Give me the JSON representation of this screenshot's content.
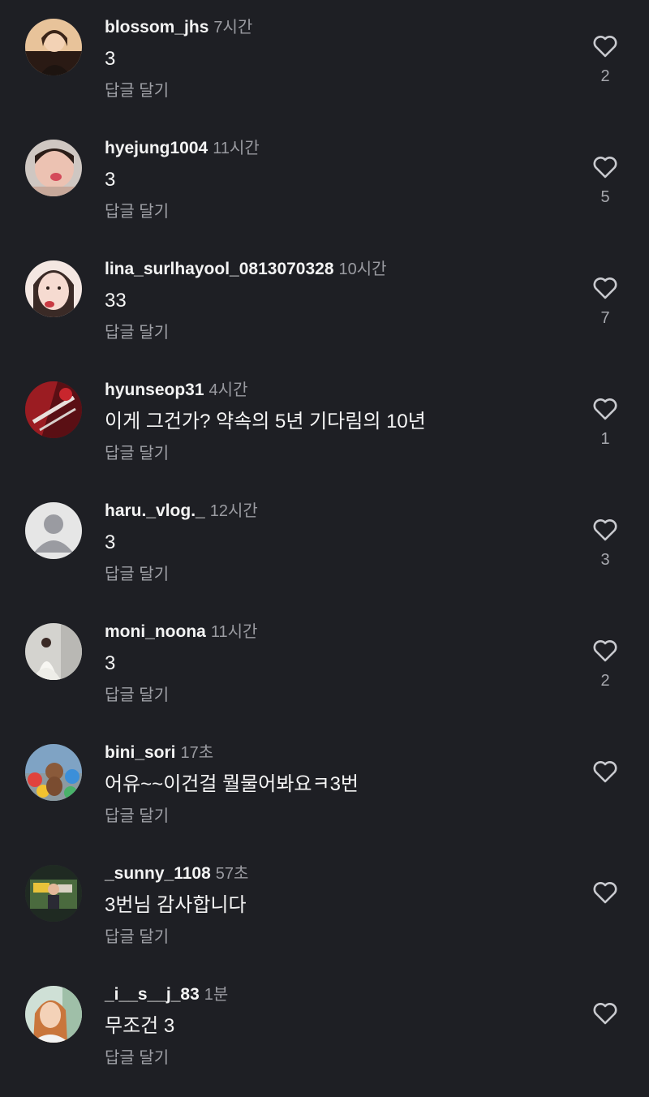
{
  "comments": [
    {
      "username": "blossom_jhs",
      "time": "7시간",
      "text": "3",
      "reply": "답글 달기",
      "likes": "2",
      "avatar": "photo-woman-dark-hair",
      "avatar_color": "#f0c8a0"
    },
    {
      "username": "hyejung1004",
      "time": "11시간",
      "text": "3",
      "reply": "답글 달기",
      "likes": "5",
      "avatar": "photo-face-closeup",
      "avatar_color": "#e8b4a8"
    },
    {
      "username": "lina_surlhayool_0813070328",
      "time": "10시간",
      "text": "33",
      "reply": "답글 달기",
      "likes": "7",
      "avatar": "photo-face-closeup",
      "avatar_color": "#f2d6cc"
    },
    {
      "username": "hyunseop31",
      "time": "4시간",
      "text": "이게 그건가? 약속의 5년 기다림의 10년",
      "reply": "답글 달기",
      "likes": "1",
      "avatar": "photo-red-artwork",
      "avatar_color": "#8a1e22"
    },
    {
      "username": "haru._vlog._",
      "time": "12시간",
      "text": "3",
      "reply": "답글 달기",
      "likes": "3",
      "avatar": "default-user-icon",
      "avatar_color": "#e6e6e6"
    },
    {
      "username": "moni_noona",
      "time": "11시간",
      "text": "3",
      "reply": "답글 달기",
      "likes": "2",
      "avatar": "photo-wedding-dress",
      "avatar_color": "#d9d7d2"
    },
    {
      "username": "bini_sori",
      "time": "17초",
      "text": "어유~~이건걸 뭘물어봐요ㅋ3번",
      "reply": "답글 달기",
      "likes": "",
      "avatar": "photo-dog-colorful-balls",
      "avatar_color": "#6a8fb0"
    },
    {
      "username": "_sunny_1108",
      "time": "57초",
      "text": "3번님 감사합니다",
      "reply": "답글 달기",
      "likes": "",
      "avatar": "photo-tv-screen",
      "avatar_color": "#2f3a2e"
    },
    {
      "username": "_i__s__j_83",
      "time": "1분",
      "text": "무조건 3",
      "reply": "답글 달기",
      "likes": "",
      "avatar": "photo-woman-outdoor",
      "avatar_color": "#d9a57a"
    }
  ],
  "colors": {
    "background": "#1e1f24",
    "username": "#f3f3f3",
    "secondary_text": "#9a9ba1",
    "heart_stroke": "#c9cacf"
  }
}
